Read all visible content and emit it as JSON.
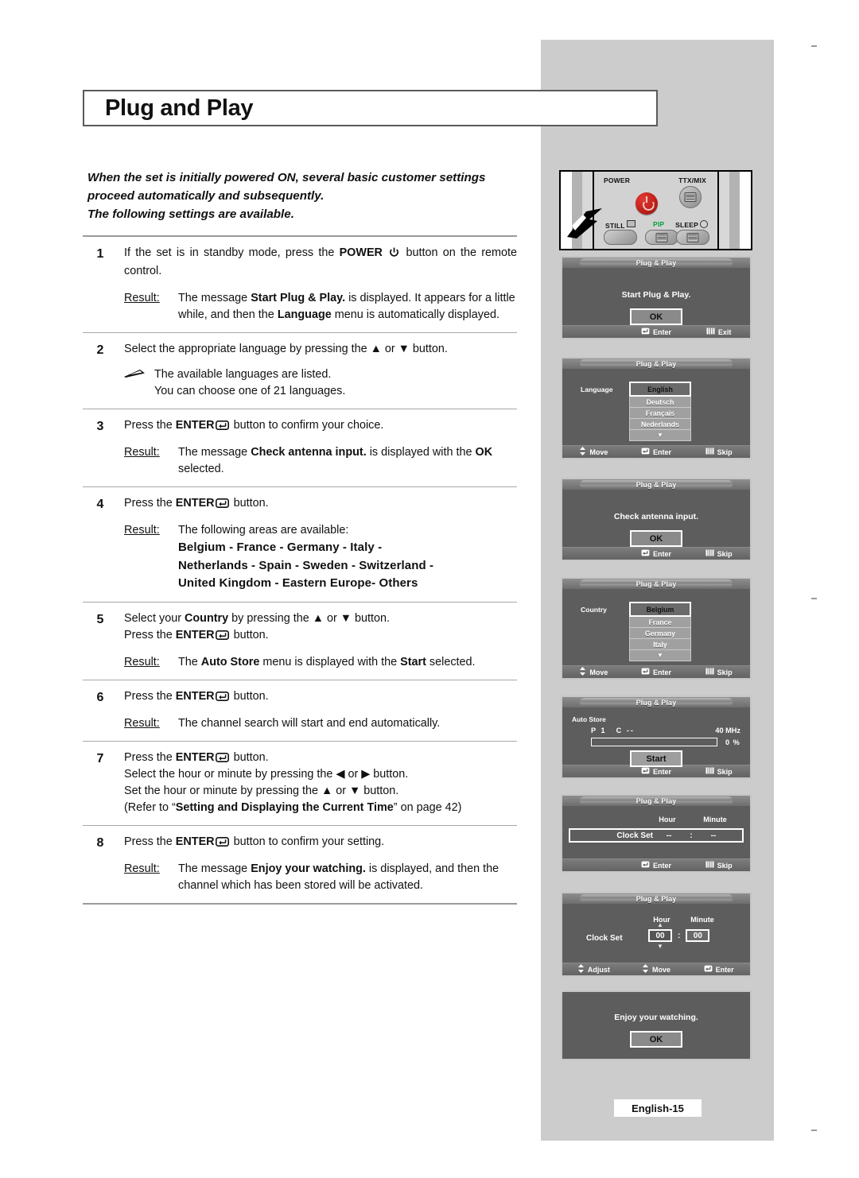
{
  "document": {
    "title": "Plug and Play",
    "page_marker": "English-15",
    "intro": "When the set is initially powered ON, several basic customer settings proceed automatically and subsequently.\nThe following settings are available."
  },
  "labels": {
    "result": "Result:"
  },
  "steps": [
    {
      "num": "1",
      "lines": [
        {
          "type": "text",
          "parts": [
            {
              "t": "If the set is in standby mode, press the "
            },
            {
              "t": "POWER",
              "b": true
            },
            {
              "t": " ",
              "icon": "power-icon"
            },
            {
              "t": " button on the remote control."
            }
          ]
        }
      ],
      "result": [
        {
          "t": "The message "
        },
        {
          "t": "Start Plug & Play.",
          "b": true
        },
        {
          "t": " is displayed. It appears for a little while, and then the "
        },
        {
          "t": "Language",
          "b": true
        },
        {
          "t": " menu is automatically displayed."
        }
      ]
    },
    {
      "num": "2",
      "lines": [
        {
          "type": "text",
          "parts": [
            {
              "t": "Select the appropriate language by pressing the ▲ or ▼ button."
            }
          ]
        }
      ],
      "note": "The available languages are listed.\nYou can choose one of 21 languages."
    },
    {
      "num": "3",
      "lines": [
        {
          "type": "text",
          "parts": [
            {
              "t": "Press the "
            },
            {
              "t": "ENTER",
              "b": true
            },
            {
              "t": "",
              "icon": "enter-icon"
            },
            {
              "t": " button to confirm your choice."
            }
          ]
        }
      ],
      "result": [
        {
          "t": "The message "
        },
        {
          "t": "Check antenna input.",
          "b": true
        },
        {
          "t": " is displayed with the "
        },
        {
          "t": "OK",
          "b": true
        },
        {
          "t": " selected."
        }
      ]
    },
    {
      "num": "4",
      "lines": [
        {
          "type": "text",
          "parts": [
            {
              "t": "Press the "
            },
            {
              "t": "ENTER",
              "b": true
            },
            {
              "t": "",
              "icon": "enter-icon"
            },
            {
              "t": " button."
            }
          ]
        }
      ],
      "result": [
        {
          "t": "The following areas are available:"
        }
      ],
      "areas": "Belgium - France - Germany - Italy -\nNetherlands - Spain - Sweden - Switzerland -\nUnited Kingdom - Eastern Europe- Others"
    },
    {
      "num": "5",
      "lines": [
        {
          "type": "text",
          "parts": [
            {
              "t": "Select your "
            },
            {
              "t": "Country",
              "b": true
            },
            {
              "t": " by pressing the ▲ or ▼ button."
            }
          ]
        },
        {
          "type": "text",
          "parts": [
            {
              "t": "Press the "
            },
            {
              "t": "ENTER",
              "b": true
            },
            {
              "t": "",
              "icon": "enter-icon"
            },
            {
              "t": " button."
            }
          ]
        }
      ],
      "result": [
        {
          "t": "The "
        },
        {
          "t": "Auto Store",
          "b": true
        },
        {
          "t": " menu is displayed with the "
        },
        {
          "t": "Start",
          "b": true
        },
        {
          "t": " selected."
        }
      ]
    },
    {
      "num": "6",
      "lines": [
        {
          "type": "text",
          "parts": [
            {
              "t": "Press the "
            },
            {
              "t": "ENTER",
              "b": true
            },
            {
              "t": "",
              "icon": "enter-icon"
            },
            {
              "t": " button."
            }
          ]
        }
      ],
      "result": [
        {
          "t": "The channel search will start and end automatically."
        }
      ]
    },
    {
      "num": "7",
      "lines": [
        {
          "type": "text",
          "parts": [
            {
              "t": "Press the "
            },
            {
              "t": "ENTER",
              "b": true
            },
            {
              "t": "",
              "icon": "enter-icon"
            },
            {
              "t": " button."
            }
          ]
        },
        {
          "type": "text",
          "parts": [
            {
              "t": "Select the hour or minute by pressing the ◀ or ▶ button."
            }
          ]
        },
        {
          "type": "text",
          "parts": [
            {
              "t": "Set the hour or minute by pressing the ▲ or ▼ button."
            }
          ]
        },
        {
          "type": "text",
          "parts": [
            {
              "t": "(Refer to “"
            },
            {
              "t": "Setting and Displaying the Current Time",
              "b": true
            },
            {
              "t": "” on page 42)"
            }
          ]
        }
      ]
    },
    {
      "num": "8",
      "lines": [
        {
          "type": "text",
          "parts": [
            {
              "t": "Press the "
            },
            {
              "t": "ENTER",
              "b": true
            },
            {
              "t": "",
              "icon": "enter-icon"
            },
            {
              "t": " button to confirm your setting."
            }
          ]
        }
      ],
      "result": [
        {
          "t": "The message "
        },
        {
          "t": "Enjoy your watching.",
          "b": true
        },
        {
          "t": " is displayed, and then the channel which has been stored will be activated."
        }
      ]
    }
  ],
  "remote": {
    "buttons": [
      {
        "name": "power",
        "label": "POWER",
        "color": "#c1201a"
      },
      {
        "name": "ttx-mix",
        "label": "TTX/MIX"
      },
      {
        "name": "still",
        "label": "STILL"
      },
      {
        "name": "pip",
        "label": "PIP",
        "color": "#00a03c"
      },
      {
        "name": "sleep",
        "label": "SLEEP"
      }
    ]
  },
  "osd": {
    "title": "Plug & Play",
    "screens": [
      {
        "id": "start",
        "has_title": true,
        "message": "Start Plug & Play.",
        "button": "OK",
        "footer": [
          "",
          "Enter",
          "Exit"
        ]
      },
      {
        "id": "language",
        "has_title": true,
        "field_label": "Language",
        "options": [
          "English",
          "Deutsch",
          "Français",
          "Nederlands"
        ],
        "selected": "English",
        "more": "▼",
        "footer": [
          "Move",
          "Enter",
          "Skip"
        ]
      },
      {
        "id": "antenna",
        "has_title": true,
        "message": "Check antenna input.",
        "button": "OK",
        "footer": [
          "",
          "Enter",
          "Skip"
        ]
      },
      {
        "id": "country",
        "has_title": true,
        "field_label": "Country",
        "options": [
          "Belgium",
          "France",
          "Germany",
          "Italy"
        ],
        "selected": "Belgium",
        "more": "▼",
        "footer": [
          "Move",
          "Enter",
          "Skip"
        ]
      },
      {
        "id": "auto-store",
        "has_title": true,
        "section_label": "Auto Store",
        "program": "P 1",
        "channel": "C --",
        "frequency": "40 MHz",
        "progress_percent": "0 %",
        "progress_value": 0,
        "button": "Start",
        "footer": [
          "",
          "Enter",
          "Skip"
        ]
      },
      {
        "id": "clock-empty",
        "has_title": true,
        "hour_header": "Hour",
        "minute_header": "Minute",
        "row_label": "Clock Set",
        "hour": "--",
        "colon": ":",
        "minute": "--",
        "footer": [
          "",
          "Enter",
          "Skip"
        ]
      },
      {
        "id": "clock-set",
        "has_title": true,
        "hour_header": "Hour",
        "minute_header": "Minute",
        "row_label": "Clock Set",
        "hour": "00",
        "colon": ":",
        "minute": "00",
        "footer": [
          "Adjust",
          "Move",
          "Enter"
        ]
      },
      {
        "id": "enjoy",
        "has_title": false,
        "message": "Enjoy your watching.",
        "button": "OK",
        "footer": []
      }
    ]
  }
}
